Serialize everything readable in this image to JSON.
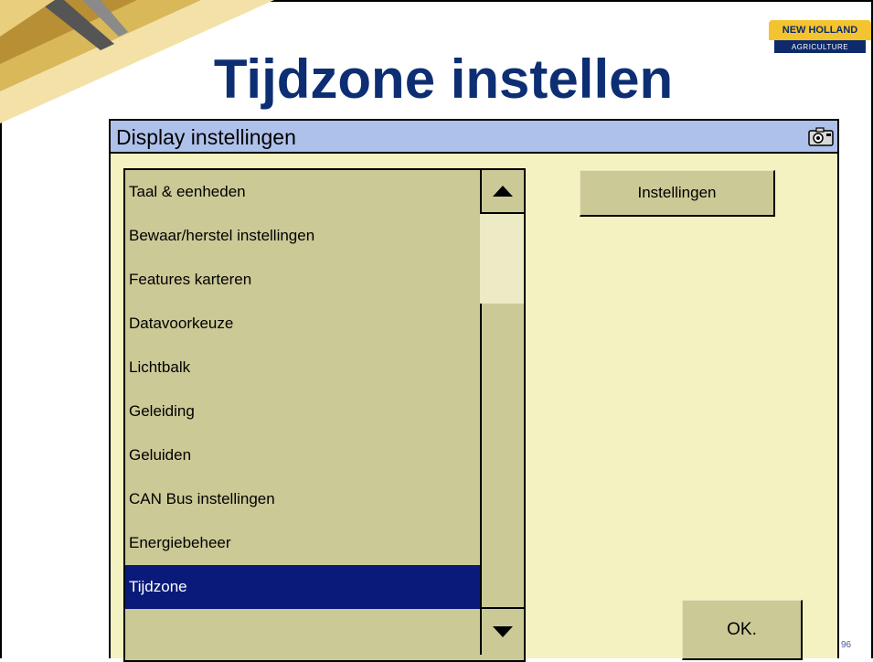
{
  "slide": {
    "title": "Tijdzone instellen",
    "page_number": "96"
  },
  "logo": {
    "brand": "NEW HOLLAND",
    "sub": "AGRICULTURE"
  },
  "window": {
    "title": "Display instellingen",
    "camera_icon": "camera-icon"
  },
  "list": {
    "items": [
      {
        "label": "Taal & eenheden",
        "selected": false
      },
      {
        "label": "Bewaar/herstel instellingen",
        "selected": false
      },
      {
        "label": "Features karteren",
        "selected": false
      },
      {
        "label": "Datavoorkeuze",
        "selected": false
      },
      {
        "label": "Lichtbalk",
        "selected": false
      },
      {
        "label": "Geleiding",
        "selected": false
      },
      {
        "label": "Geluiden",
        "selected": false
      },
      {
        "label": "CAN Bus instellingen",
        "selected": false
      },
      {
        "label": "Energiebeheer",
        "selected": false
      },
      {
        "label": "Tijdzone",
        "selected": true
      }
    ]
  },
  "buttons": {
    "settings_label": "Instellingen",
    "ok_label": "OK."
  },
  "colors": {
    "title_blue": "#0d2e73",
    "titlebar": "#aec1ea",
    "panel_bg": "#f5f2c2",
    "list_bg": "#cbc996",
    "selection": "#0a1a7a"
  }
}
